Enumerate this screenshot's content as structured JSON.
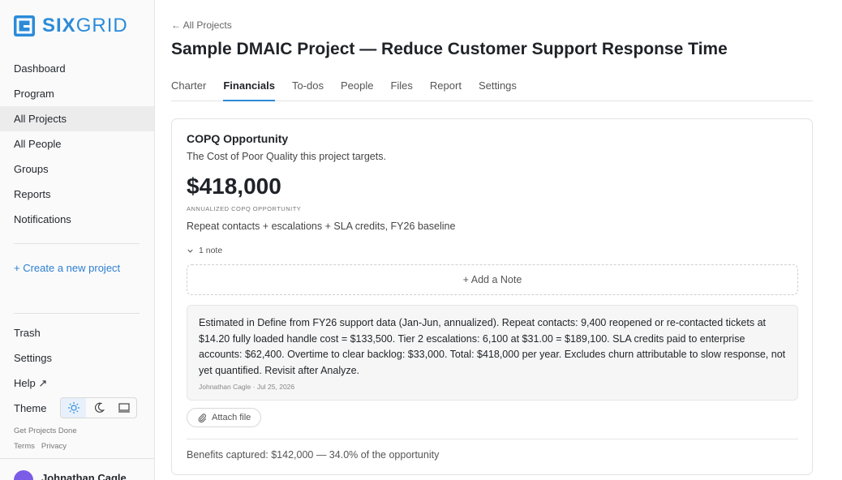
{
  "brand": {
    "name_bold": "SIX",
    "name_light": "GRID",
    "color": "#2b8bd9"
  },
  "sidebar": {
    "items": [
      {
        "label": "Dashboard"
      },
      {
        "label": "Program"
      },
      {
        "label": "All Projects",
        "active": true
      },
      {
        "label": "All People"
      },
      {
        "label": "Groups"
      },
      {
        "label": "Reports"
      },
      {
        "label": "Notifications"
      }
    ],
    "create_label": "+ Create a new project",
    "bottom_items": [
      {
        "label": "Trash"
      },
      {
        "label": "Settings"
      },
      {
        "label": "Help ↗"
      }
    ],
    "theme_label": "Theme",
    "theme_options": [
      "sun-icon",
      "moon-icon",
      "monitor-icon"
    ],
    "tagline": "Get Projects Done",
    "terms": "Terms",
    "privacy": "Privacy",
    "user_name": "Johnathan Cagle"
  },
  "header": {
    "back_label": "← All Projects",
    "title": "Sample DMAIC Project — Reduce Customer Support Response Time",
    "tabs": [
      {
        "label": "Charter"
      },
      {
        "label": "Financials",
        "active": true
      },
      {
        "label": "To-dos"
      },
      {
        "label": "People"
      },
      {
        "label": "Files"
      },
      {
        "label": "Report"
      },
      {
        "label": "Settings"
      }
    ]
  },
  "copq": {
    "title": "COPQ Opportunity",
    "subtitle": "The Cost of Poor Quality this project targets.",
    "amount": "$418,000",
    "amount_label": "ANNUALIZED COPQ OPPORTUNITY",
    "description": "Repeat contacts + escalations + SLA credits, FY26 baseline",
    "note_toggle": "1 note",
    "add_note_label": "+ Add a Note",
    "note": {
      "text": "Estimated in Define from FY26 support data (Jan-Jun, annualized). Repeat contacts: 9,400 reopened or re-contacted tickets at $14.20 fully loaded handle cost = $133,500. Tier 2 escalations: 6,100 at $31.00 = $189,100. SLA credits paid to enterprise accounts: $62,400. Overtime to clear backlog: $33,000. Total: $418,000 per year. Excludes churn attributable to slow response, not yet quantified. Revisit after Analyze.",
      "meta": "Johnathan Cagle · Jul 25, 2026"
    },
    "attach_label": "Attach file",
    "benefits": "Benefits captured: $142,000 — 34.0% of the opportunity"
  }
}
